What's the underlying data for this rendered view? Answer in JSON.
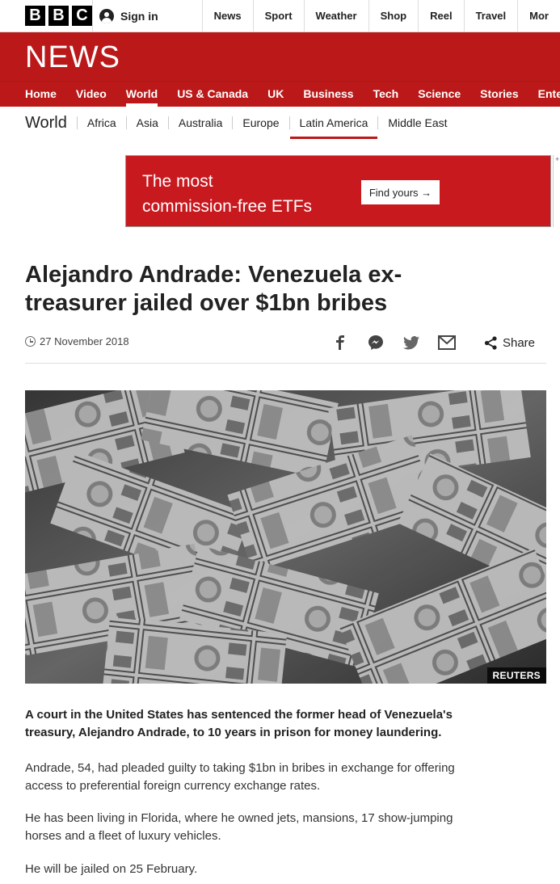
{
  "topbar": {
    "logo_letters": [
      "B",
      "B",
      "C"
    ],
    "signin_label": "Sign in",
    "nav": [
      "News",
      "Sport",
      "Weather",
      "Shop",
      "Reel",
      "Travel",
      "Mor"
    ]
  },
  "news_header": {
    "title": "NEWS",
    "nav": [
      "Home",
      "Video",
      "World",
      "US & Canada",
      "UK",
      "Business",
      "Tech",
      "Science",
      "Stories",
      "Enterta"
    ],
    "active": "World"
  },
  "world_nav": {
    "title": "World",
    "items": [
      "Africa",
      "Asia",
      "Australia",
      "Europe",
      "Latin America",
      "Middle East"
    ],
    "active": "Latin America"
  },
  "ad": {
    "line1": "The most",
    "line2": "commission-free ETFs",
    "button": "Find yours →",
    "corner": "+"
  },
  "article": {
    "headline_line1": "Alejandro Andrade: Venezuela ex-",
    "headline_line2": "treasurer jailed over $1bn bribes",
    "date": "27 November 2018",
    "share_label": "Share",
    "image_credit": "REUTERS",
    "lead_line1": "A court in the United States has sentenced the former head of Venezuela's",
    "lead_line2": "treasury, Alejandro Andrade, to 10 years in prison for money laundering.",
    "p1_line1": "Andrade, 54, had pleaded guilty to taking $1bn in bribes in exchange for offering",
    "p1_line2": "access to preferential foreign currency exchange rates.",
    "p2_line1": "He has been living in Florida, where he owned jets, mansions, 17 show-jumping",
    "p2_line2": "horses and a fleet of luxury vehicles.",
    "p3": "He will be jailed on 25 February."
  },
  "icons": [
    "user-icon",
    "clock-icon",
    "facebook-icon",
    "messenger-icon",
    "twitter-icon",
    "email-icon",
    "share-icon"
  ],
  "colors": {
    "brand_red": "#bb1919",
    "ad_red": "#c8191f"
  }
}
